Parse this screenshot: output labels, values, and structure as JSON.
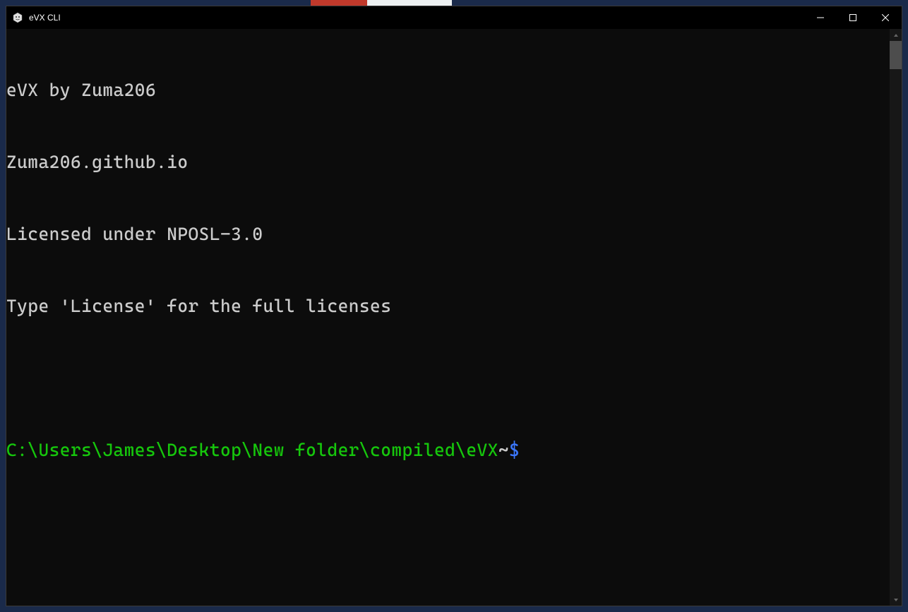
{
  "window": {
    "title": "eVX CLI"
  },
  "terminal": {
    "lines": [
      "eVX by Zuma206",
      "Zuma206.github.io",
      "Licensed under NPOSL-3.0",
      "Type 'License' for the full licenses"
    ],
    "prompt": {
      "path": "C:\\Users\\James\\Desktop\\New folder\\compiled\\eVX",
      "separator": "~",
      "symbol": "$"
    }
  }
}
